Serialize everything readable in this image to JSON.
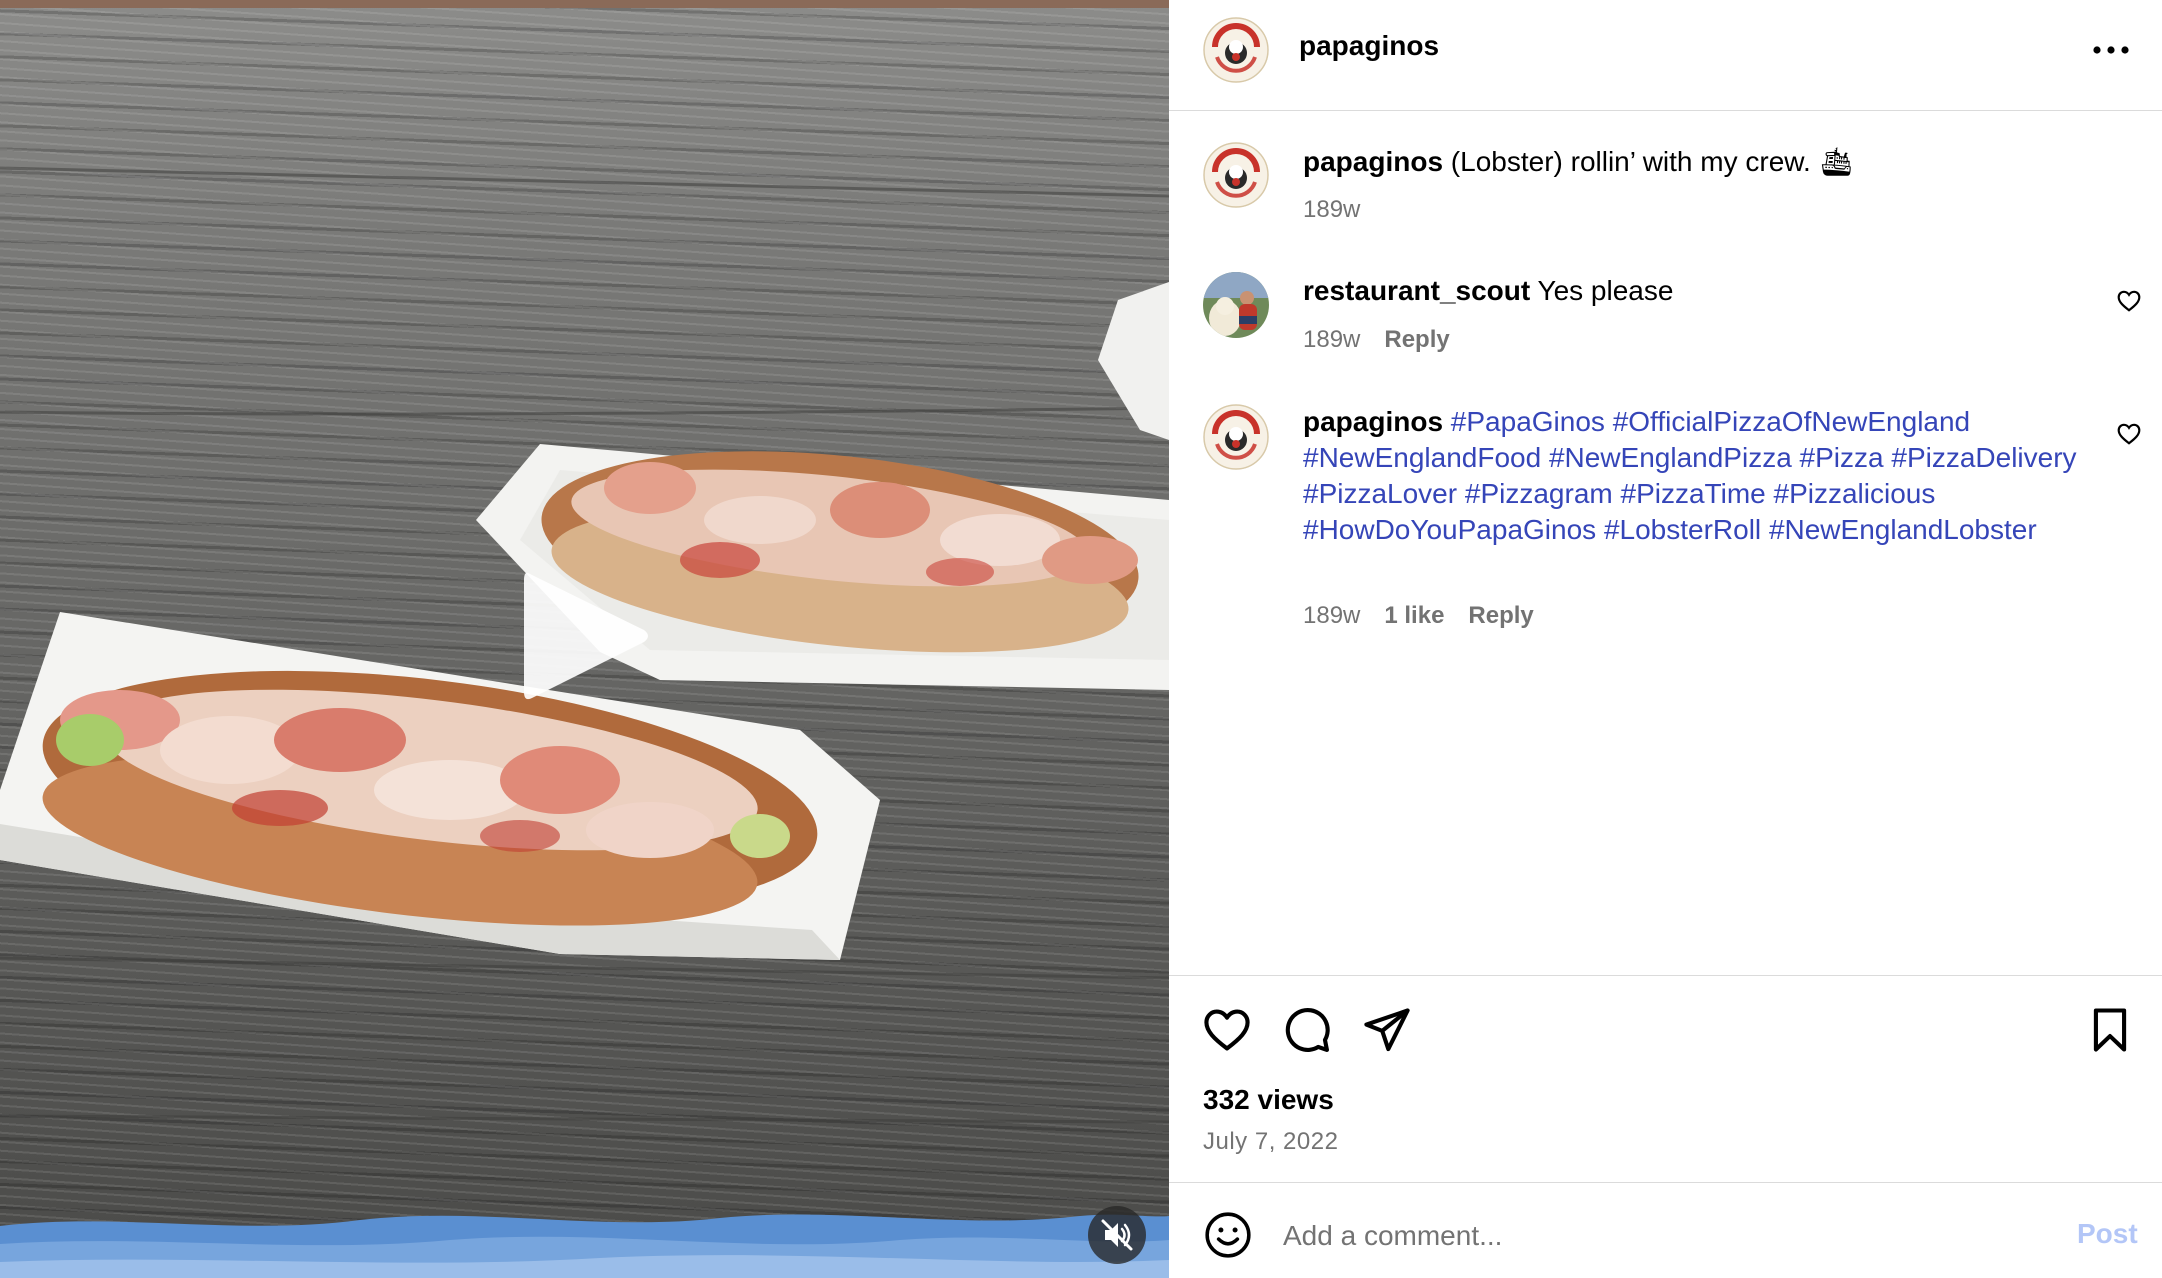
{
  "media": {
    "play_icon": "play-icon",
    "mute_icon": "muted-speaker-icon"
  },
  "post": {
    "username": "papaginos",
    "more_icon": "ellipsis-icon"
  },
  "comments": [
    {
      "username": "papaginos",
      "text": "(Lobster) rollin’ with my crew.",
      "emoji": "🛳",
      "age": "189w"
    },
    {
      "username": "restaurant_scout",
      "text": "Yes please",
      "age": "189w",
      "reply_label": "Reply"
    },
    {
      "username": "papaginos",
      "hashtags": [
        "#PapaGinos",
        "#OfficialPizzaOfNewEngland",
        "#NewEnglandFood",
        "#NewEnglandPizza",
        "#Pizza",
        "#PizzaDelivery",
        "#PizzaLover",
        "#Pizzagram",
        "#PizzaTime",
        "#Pizzalicious",
        "#HowDoYouPapaGinos",
        "#LobsterRoll",
        "#NewEnglandLobster"
      ],
      "age": "189w",
      "likes": "1 like",
      "reply_label": "Reply"
    }
  ],
  "stats": {
    "views": "332 views",
    "date": "July 7, 2022"
  },
  "composer": {
    "placeholder": "Add a comment...",
    "post_label": "Post"
  },
  "colors": {
    "hashtag": "#3545b8",
    "muted_text": "#737373",
    "post_disabled": "#b3c6f7",
    "divider": "#dbdbdb"
  }
}
